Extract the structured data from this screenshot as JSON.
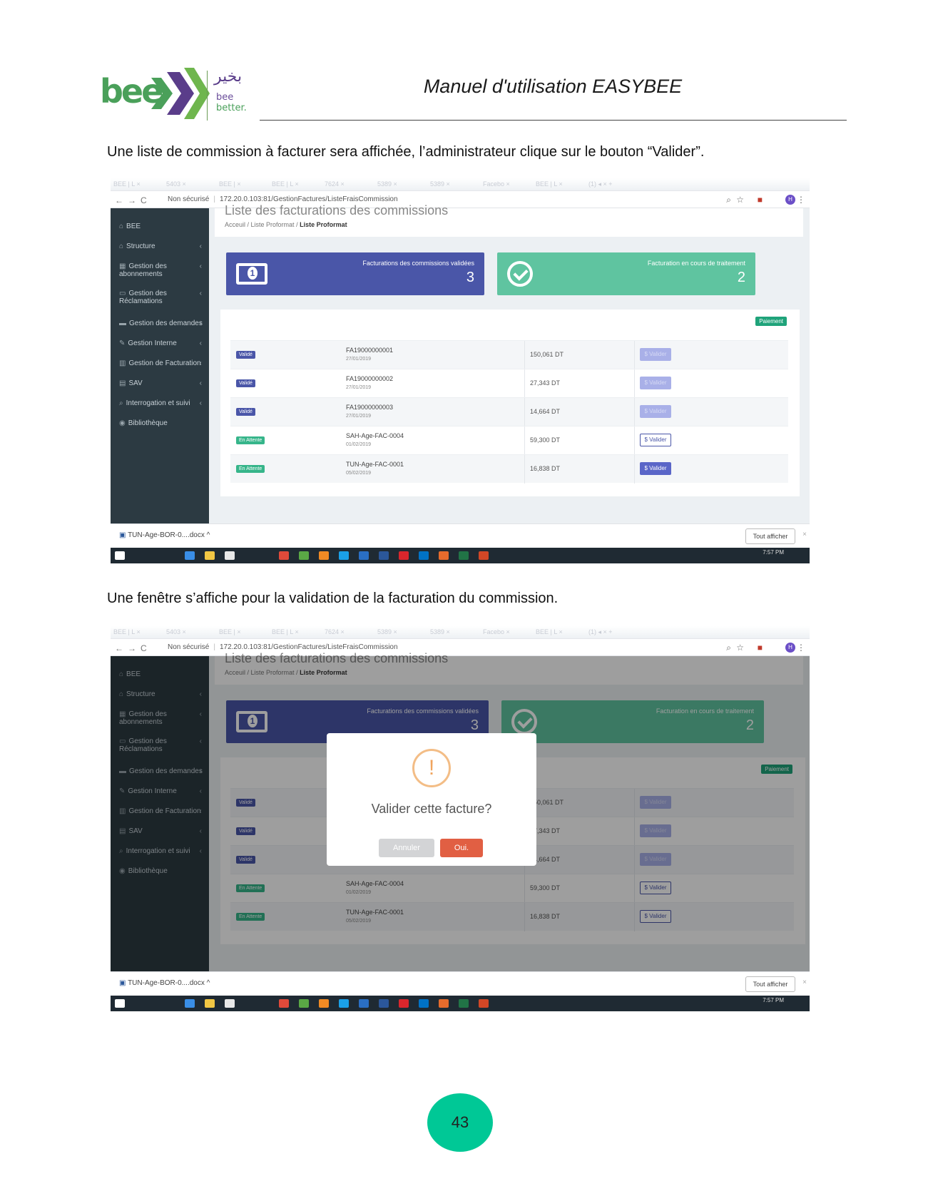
{
  "header": {
    "logo_text": "bee",
    "logo_arabic": "بخير",
    "logo_tag1": "bee",
    "logo_tag2": "better.",
    "doc_title": "Manuel d'utilisation EASYBEE"
  },
  "paragraph1": "Une liste de commission à facturer sera affichée, l’administrateur clique sur le bouton “Valider”.",
  "paragraph2": "Une fenêtre s’affiche pour la validation de la facturation du commission.",
  "browser": {
    "security": "Non sécurisé",
    "url": "172.20.0.103:81/GestionFactures/ListeFraisCommission",
    "avatar": "H"
  },
  "sidebar": {
    "items": [
      {
        "label": "BEE",
        "icon": "home-icon",
        "chev": ""
      },
      {
        "label": "Structure",
        "icon": "home-icon",
        "chev": "‹"
      },
      {
        "label": "Gestion des abonnements",
        "icon": "grid-icon",
        "chev": "‹"
      },
      {
        "label": "Gestion des Réclamations",
        "icon": "monitor-icon",
        "chev": "‹"
      },
      {
        "label": "Gestion des demandes",
        "icon": "list-icon",
        "chev": "‹"
      },
      {
        "label": "Gestion Interne",
        "icon": "edit-icon",
        "chev": "‹"
      },
      {
        "label": "Gestion de Facturation",
        "icon": "chart-icon",
        "chev": "‹"
      },
      {
        "label": "SAV",
        "icon": "ticket-icon",
        "chev": "‹"
      },
      {
        "label": "Interrogation et suivi",
        "icon": "search-icon",
        "chev": "‹"
      },
      {
        "label": "Bibliothèque",
        "icon": "book-icon",
        "chev": ""
      }
    ]
  },
  "page": {
    "title": "Liste des facturations des commissions",
    "crumb1": "Acceuil",
    "crumb2": "Liste Proformat",
    "crumb3": "Liste Proformat"
  },
  "cards": {
    "validated_title": "Facturations des commissions validées",
    "validated_value": "3",
    "pending_title": "Facturation en cours de traitement",
    "pending_value": "2"
  },
  "table": {
    "payment_badge": "Paiement",
    "rows": [
      {
        "status": "Validé",
        "ref": "FA19000000001",
        "date": "27/01/2019",
        "amount": "150,061 DT",
        "button": "$ Valider"
      },
      {
        "status": "Validé",
        "ref": "FA19000000002",
        "date": "27/01/2019",
        "amount": "27,343 DT",
        "button": "$ Valider"
      },
      {
        "status": "Validé",
        "ref": "FA19000000003",
        "date": "27/01/2019",
        "amount": "14,664 DT",
        "button": "$ Valider"
      },
      {
        "status": "En Attente",
        "ref": "SAH-Age-FAC-0004",
        "date": "01/02/2019",
        "amount": "59,300 DT",
        "button": "$ Valider"
      },
      {
        "status": "En Attente",
        "ref": "TUN-Age-FAC-0001",
        "date": "05/02/2019",
        "amount": "16,838 DT",
        "button": "$ Valider"
      }
    ]
  },
  "downloads": {
    "file": "TUN-Age-BOR-0....docx",
    "show_all": "Tout afficher"
  },
  "clock": "7:57 PM",
  "modal": {
    "question": "Valider cette facture?",
    "cancel": "Annuler",
    "ok": "Oui."
  },
  "page_number": "43",
  "colors": {
    "primary": "#4a56a8",
    "success": "#5fc4a0",
    "danger": "#e15f43",
    "page_badge": "#00c896"
  }
}
